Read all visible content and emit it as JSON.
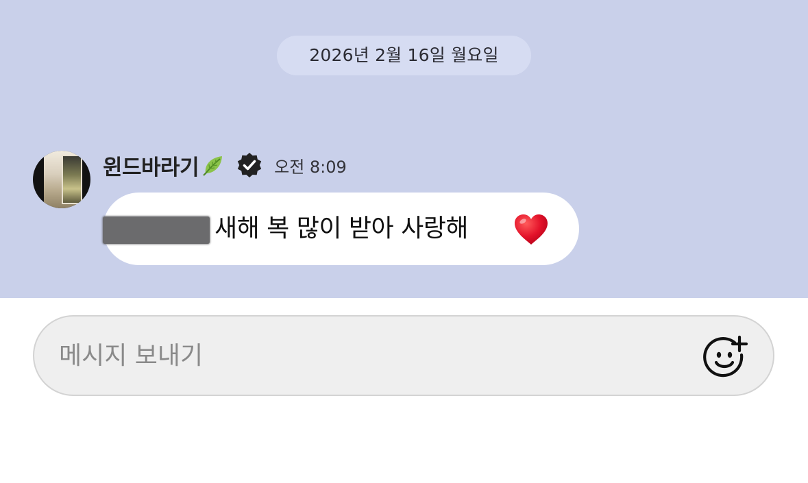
{
  "chat": {
    "date_separator": "2026년 2월 16일 월요일",
    "message": {
      "sender": "윈드바라기",
      "time": "오전 8:09",
      "text": "새해 복 많이 받아 사랑해",
      "sender_emoji_icon": "leaf-icon",
      "badge_icon": "verified-badge-icon",
      "trailing_emoji_icon": "red-heart-icon"
    }
  },
  "composer": {
    "placeholder": "메시지 보내기",
    "value": "",
    "emoji_button_icon": "smiley-plus-icon"
  },
  "colors": {
    "chat_background": "#c9d0ea",
    "date_chip": "#d6dcf2",
    "bubble": "#ffffff",
    "composer_background": "#efefef",
    "heart": "#e3122a"
  }
}
